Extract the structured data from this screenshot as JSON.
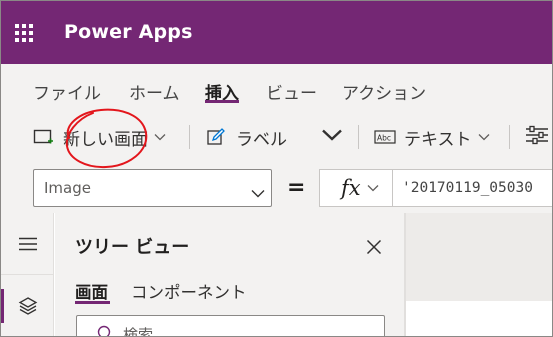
{
  "app": {
    "title": "Power Apps"
  },
  "menu": {
    "tabs": [
      {
        "label": "ファイル",
        "active": false
      },
      {
        "label": "ホーム",
        "active": false
      },
      {
        "label": "挿入",
        "active": true
      },
      {
        "label": "ビュー",
        "active": false
      },
      {
        "label": "アクション",
        "active": false
      }
    ]
  },
  "commands": {
    "new_screen": "新しい画面",
    "label": "ラベル",
    "text": "テキスト"
  },
  "formula": {
    "property": "Image",
    "equals": "=",
    "fx": "fx",
    "value": "'20170119_05030"
  },
  "tree": {
    "title": "ツリー ビュー",
    "tabs": [
      {
        "label": "画面",
        "active": true
      },
      {
        "label": "コンポーネント",
        "active": false
      }
    ],
    "search_placeholder": "検索"
  },
  "colors": {
    "brand": "#742774",
    "annotation": "#e3161c"
  },
  "icons": {
    "waffle": "app-launcher-icon",
    "new_screen": "new-screen-icon",
    "label": "edit-label-icon",
    "text": "text-input-icon",
    "controls": "sliders-icon",
    "rail_menu": "hamburger-icon",
    "rail_layers": "layers-icon",
    "close": "close-icon",
    "search": "search-icon"
  }
}
